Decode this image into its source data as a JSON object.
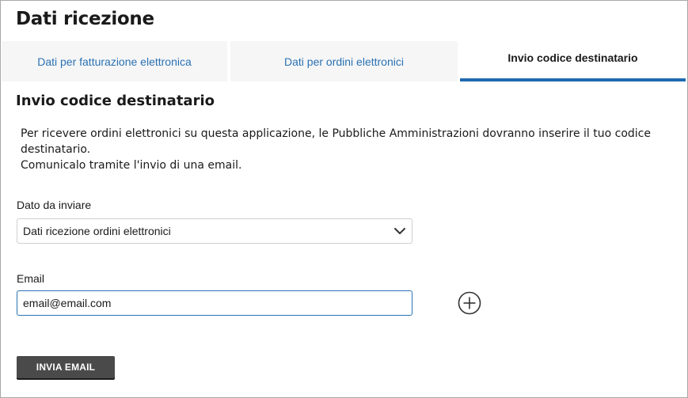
{
  "page": {
    "title": "Dati ricezione"
  },
  "tabs": [
    {
      "label": "Dati per fatturazione elettronica",
      "active": false
    },
    {
      "label": "Dati per ordini elettronici",
      "active": false
    },
    {
      "label": "Invio codice destinatario",
      "active": true
    }
  ],
  "section": {
    "title": "Invio codice destinatario",
    "description_line1": "Per ricevere ordini elettronici su questa applicazione, le Pubbliche Amministrazioni dovranno inserire il tuo codice destinatario.",
    "description_line2": "Comunicalo tramite l'invio di una email."
  },
  "form": {
    "dato_label": "Dato da inviare",
    "dato_selected": "Dati ricezione ordini elettronici",
    "email_label": "Email",
    "email_value": "email@email.com",
    "send_label": "INVIA EMAIL"
  },
  "icons": {
    "select_chevron": "chevron-down-icon",
    "add_email": "plus-circle-icon"
  },
  "colors": {
    "accent": "#1f6ab0",
    "tab_link": "#2a72b4",
    "button_bg": "#4a4a4a"
  }
}
